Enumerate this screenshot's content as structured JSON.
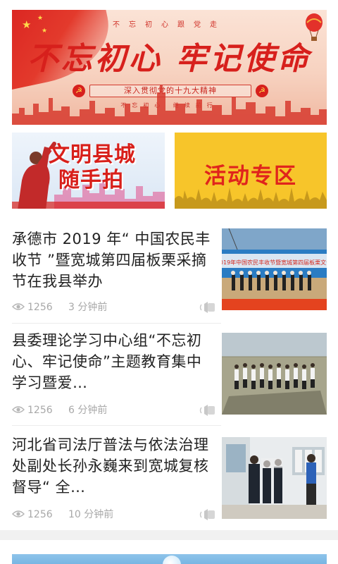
{
  "hero": {
    "top_slogan": "不忘初心跟党走",
    "title": "不忘初心 牢记使命",
    "ribbon": "深入贯彻党的十九大精神",
    "sub_slogan": "不忘初心 继续前行"
  },
  "banners": {
    "civil": {
      "line1": "文明县城",
      "line2": "随手拍"
    },
    "activity": {
      "label": "活动专区"
    }
  },
  "news": [
    {
      "title": "承德市 2019 年“ 中国农民丰收节 ”暨宽城第四届板栗采摘节在我县举办",
      "views": "1256",
      "time": "3 分钟前",
      "thumb_icon": "harvest-festival-photo"
    },
    {
      "title": "县委理论学习中心组“不忘初心、牢记使命”主题教育集中学习暨爱…",
      "views": "1256",
      "time": "6 分钟前",
      "thumb_icon": "group-photo"
    },
    {
      "title": "河北省司法厅普法与依法治理处副处长孙永巍来到宽城复核督导“ 全…",
      "views": "1256",
      "time": "10 分钟前",
      "thumb_icon": "office-visit-photo"
    }
  ],
  "colors": {
    "accent_red": "#d7201c",
    "banner_yellow": "#f7c52a",
    "meta_gray": "#a8a8a8"
  }
}
